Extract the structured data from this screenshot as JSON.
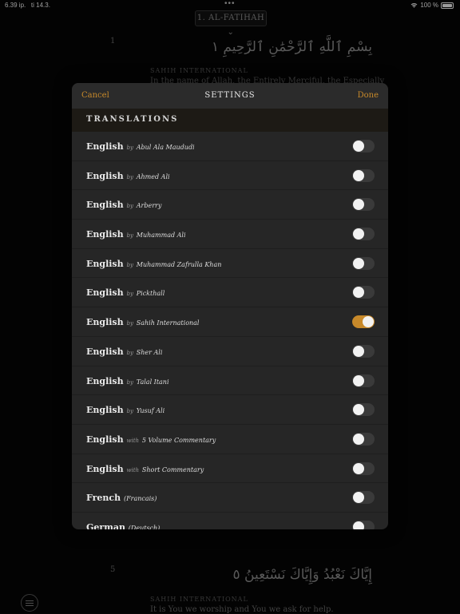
{
  "status": {
    "time": "6.39 ip.",
    "date": "ti 14.3.",
    "battery": "100 %",
    "dots": "•••"
  },
  "reader": {
    "surah_title": "1. AL-FATIHAH",
    "verse1_num": "1",
    "verse1_arabic": "بِسْمِ ٱللَّهِ ٱلرَّحْمَٰنِ ٱلرَّحِيمِ ١",
    "verse1_trans_label": "SAHIH INTERNATIONAL",
    "verse1_trans_text": "In the name of Allah, the Entirely Merciful, the Especially",
    "verse5_num": "5",
    "verse5_arabic": "إِيَّاكَ نَعْبُدُ وَإِيَّاكَ نَسْتَعِينُ ٥",
    "verse5_trans_label": "SAHIH INTERNATIONAL",
    "verse5_trans_text": "It is You we worship and You we ask for help."
  },
  "modal": {
    "cancel": "Cancel",
    "title": "SETTINGS",
    "done": "Done",
    "section": "TRANSLATIONS",
    "accent": "#c7892a",
    "items": [
      {
        "lang": "English",
        "prep": "by",
        "name": "Abul Ala Maududi",
        "on": false
      },
      {
        "lang": "English",
        "prep": "by",
        "name": "Ahmed Ali",
        "on": false
      },
      {
        "lang": "English",
        "prep": "by",
        "name": "Arberry",
        "on": false
      },
      {
        "lang": "English",
        "prep": "by",
        "name": "Muhammad Ali",
        "on": false
      },
      {
        "lang": "English",
        "prep": "by",
        "name": "Muhammad Zafrulla Khan",
        "on": false
      },
      {
        "lang": "English",
        "prep": "by",
        "name": "Pickthall",
        "on": false
      },
      {
        "lang": "English",
        "prep": "by",
        "name": "Sahih International",
        "on": true
      },
      {
        "lang": "English",
        "prep": "by",
        "name": "Sher Ali",
        "on": false
      },
      {
        "lang": "English",
        "prep": "by",
        "name": "Talal Itani",
        "on": false
      },
      {
        "lang": "English",
        "prep": "by",
        "name": "Yusuf Ali",
        "on": false
      },
      {
        "lang": "English",
        "prep": "with",
        "name": "5 Volume Commentary",
        "on": false
      },
      {
        "lang": "English",
        "prep": "with",
        "name": "Short Commentary",
        "on": false
      },
      {
        "lang": "French",
        "prep": "",
        "name": "(Francais)",
        "on": false
      },
      {
        "lang": "German",
        "prep": "",
        "name": "(Deutsch)",
        "on": false
      }
    ]
  }
}
